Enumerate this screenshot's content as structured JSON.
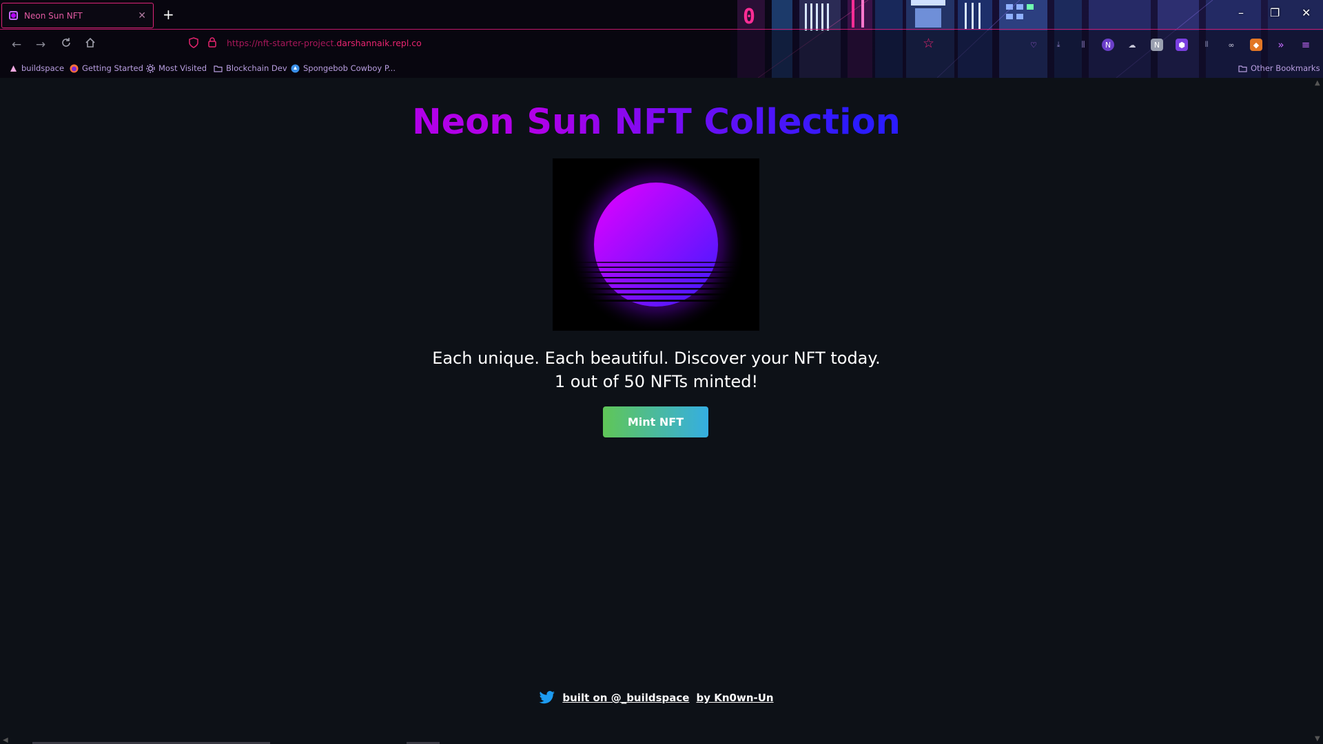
{
  "browser": {
    "tab": {
      "title": "Neon Sun NFT",
      "close": "✕"
    },
    "new_tab": "+",
    "window": {
      "minimize": "–",
      "restore": "❐",
      "close": "✕"
    },
    "url": {
      "prefix": "https://nft-starter-project.",
      "domain": "darshannaik.repl.co"
    },
    "bookmarks": [
      {
        "label": "buildspace",
        "icon": "buildspace-icon"
      },
      {
        "label": "Getting Started",
        "icon": "firefox-icon"
      },
      {
        "label": "Most Visited",
        "icon": "gear-icon"
      },
      {
        "label": "Blockchain Dev",
        "icon": "folder-icon"
      },
      {
        "label": "Spongebob Cowboy P...",
        "icon": "globe-icon"
      }
    ],
    "other_bookmarks": "Other Bookmarks",
    "accent_color": "#e8246f"
  },
  "page": {
    "title": "Neon Sun NFT Collection",
    "tagline": "Each unique. Each beautiful. Discover your NFT today.",
    "minted": "1 out of 50 NFTs minted!",
    "mint_button": "Mint NFT",
    "footer": {
      "built_on": "built on @_buildspace",
      "by": "by Kn0wn-Un"
    },
    "colors": {
      "title_gradient": [
        "#b100e8",
        "#2b1bff"
      ],
      "button_gradient": [
        "#60c657",
        "#35aee2"
      ],
      "sun_gradient": [
        "#e600ff",
        "#3b1bff"
      ]
    }
  }
}
